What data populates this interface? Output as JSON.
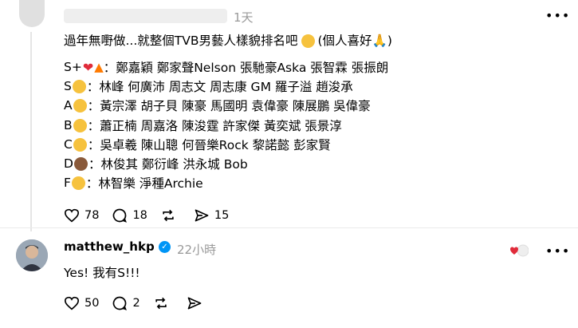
{
  "post": {
    "time": "1天",
    "title": "過年無嘢做...就整個TVB男藝人樣貌排名吧",
    "title_suffix": "(個人喜好",
    "title_suffix_close": ")",
    "ranks": [
      {
        "tier": "S+",
        "names": "：鄭嘉穎 鄭家聲Nelson 張馳豪Aska 張智霖 張振朗"
      },
      {
        "tier": "S",
        "names": "：林峰 何廣沛 周志文 周志康 GM 羅子溢 趙浚承"
      },
      {
        "tier": "A",
        "names": "：黃宗澤 胡子貝 陳豪 馬國明 袁偉豪 陳展鵬 吳偉豪"
      },
      {
        "tier": "B",
        "names": "：蕭正楠 周嘉洛 陳浚霆 許家傑 黃奕斌 張景淳"
      },
      {
        "tier": "C",
        "names": "：吳卓羲 陳山聰 何晉樂Rock 黎諾懿 彭家賢"
      },
      {
        "tier": "D",
        "names": "：林俊其 鄭衍峰 洪永城 Bob"
      },
      {
        "tier": "F",
        "names": "：林智樂 淨種Archie"
      }
    ],
    "likes": "78",
    "comments": "18",
    "shares": "15"
  },
  "reply": {
    "username": "matthew_hkp",
    "time": "22小時",
    "text": "Yes! 我有S!!!",
    "likes": "50",
    "comments": "2"
  },
  "colors": {
    "accent": "#0095f6",
    "heart": "#e02b3a",
    "muted": "#999999"
  }
}
